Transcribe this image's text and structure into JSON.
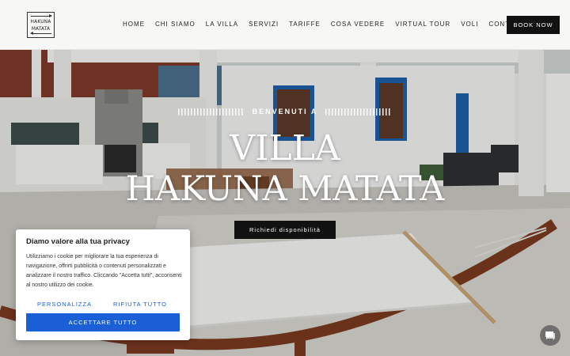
{
  "logo": {
    "line1": "HAKUNA",
    "line2": "MATATA"
  },
  "nav": {
    "items": [
      "HOME",
      "CHI SIAMO",
      "LA VILLA",
      "SERVIZI",
      "TARIFFE",
      "COSA VEDERE",
      "VIRTUAL TOUR",
      "VOLI",
      "CONTATTI"
    ],
    "book_label": "BOOK NOW"
  },
  "hero": {
    "welcome": "BENVENUTI A",
    "title_line1": "VILLA",
    "title_line2": "HAKUNA MATATA",
    "cta_label": "Richiedi disponibilità"
  },
  "cookie": {
    "title": "Diamo valore alla tua privacy",
    "body": "Utilizziamo i cookie per migliorare la tua esperienza di navigazione, offrirti pubblicità o contenuti personalizzati e analizzare il nostro traffico. Cliccando \"Accetta tutti\", acconsenti al nostro utilizzo dei cookie.",
    "customize_label": "PERSONALIZZA",
    "reject_label": "RIFIUTA TUTTO",
    "accept_label": "ACCETTARE TUTTO"
  },
  "colors": {
    "accent_blue": "#1a5fd6",
    "dark": "#111111",
    "door_blue": "#1e5fa8"
  },
  "icons": {
    "chat": "chat-bubble-icon"
  }
}
